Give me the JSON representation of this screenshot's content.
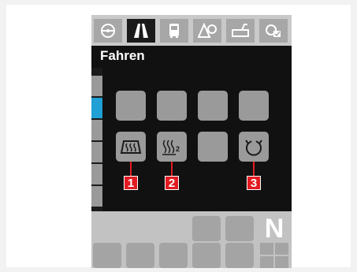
{
  "tabs": [
    {
      "icon": "steering-wheel-icon",
      "active": false
    },
    {
      "icon": "road-icon",
      "active": true
    },
    {
      "icon": "bus-icon",
      "active": false
    },
    {
      "icon": "warning-sign-icon",
      "active": false
    },
    {
      "icon": "vehicle-service-icon",
      "active": false
    },
    {
      "icon": "settings-check-icon",
      "active": false
    }
  ],
  "header": {
    "title": "Fahren"
  },
  "buttons": {
    "row1": [
      {
        "icon": "empty",
        "label": ""
      },
      {
        "icon": "empty",
        "label": ""
      },
      {
        "icon": "empty",
        "label": ""
      },
      {
        "icon": "empty",
        "label": ""
      }
    ],
    "row2": [
      {
        "icon": "rear-window-heating-icon",
        "callout": "1"
      },
      {
        "icon": "heating-stage-icon",
        "label": "2",
        "callout": "2"
      },
      {
        "icon": "empty",
        "callout": ""
      },
      {
        "icon": "recirculation-icon",
        "callout": "3"
      }
    ]
  },
  "gear": {
    "value": "N"
  },
  "colors": {
    "accent": "#21a0d6",
    "callout": "#e21b22"
  }
}
